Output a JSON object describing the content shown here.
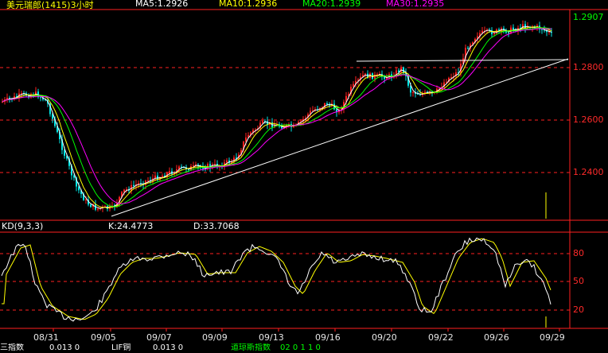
{
  "header": {
    "title": "美元瑞郎(1415)3小时",
    "ma5": "MA5:1.2926",
    "ma10": "MA10:1.2936",
    "ma20": "MA20:1.2939",
    "ma30": "MA30:1.2935"
  },
  "price_axis": {
    "current_price": "1.2907",
    "ticks": [
      "1.2800",
      "1.2600",
      "1.2400"
    ]
  },
  "kd_header": {
    "title": "KD(9,3,3)",
    "k": "K:24.4773",
    "d": "D:33.7068"
  },
  "kd_axis": {
    "ticks": [
      "80",
      "50",
      "20"
    ]
  },
  "x_axis": {
    "labels": [
      "08/31",
      "09/05",
      "09/07",
      "09/09",
      "09/13",
      "09/16",
      "09/20",
      "09/22",
      "09/26",
      "09/29"
    ]
  },
  "bottom_bar": {
    "tabs": [
      "三指数",
      "LIF铜",
      "道琼斯指数"
    ],
    "values": [
      "0.013 0",
      "0.013 0",
      "02 0 1 1 0"
    ]
  },
  "colors": {
    "up_candle": "#ff2020",
    "down_candle": "#00e6e6",
    "ma5": "#ffffff",
    "ma10": "#ffff00",
    "ma20": "#00ff00",
    "ma30": "#ff00ff",
    "grid": "#ff2020",
    "kd_k": "#ffffff",
    "kd_d": "#ffff00"
  }
}
